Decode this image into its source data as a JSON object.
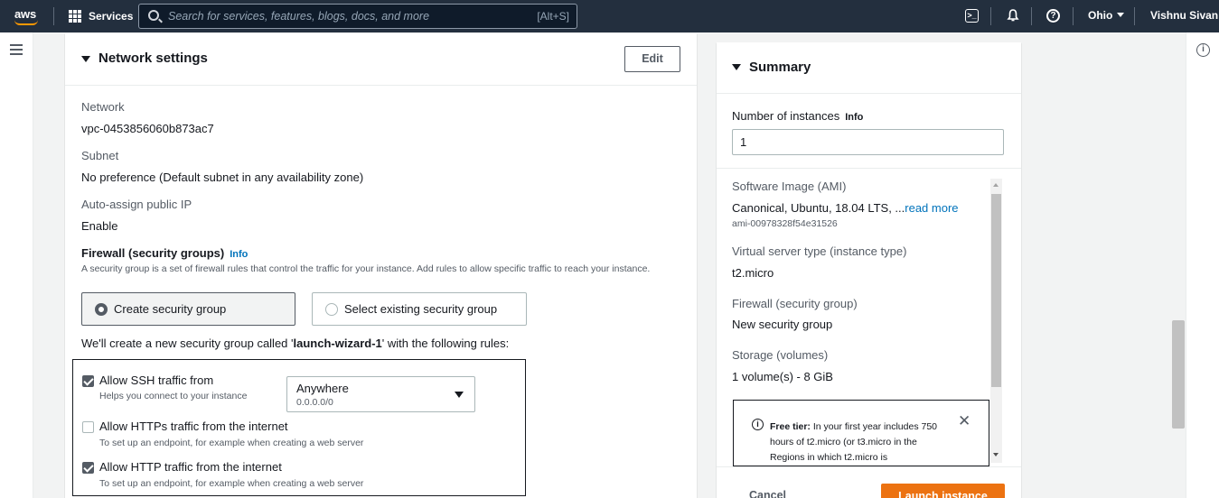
{
  "topnav": {
    "logo_text": "aws",
    "services_label": "Services",
    "search_placeholder": "Search for services, features, blogs, docs, and more",
    "search_shortcut": "[Alt+S]",
    "region": "Ohio",
    "user": "Vishnu Sivan",
    "icons": [
      "cloudshell-icon",
      "bell-icon",
      "help-icon"
    ]
  },
  "network": {
    "title": "Network settings",
    "edit_label": "Edit",
    "network_label": "Network",
    "network_value": "vpc-0453856060b873ac7",
    "subnet_label": "Subnet",
    "subnet_value": "No preference (Default subnet in any availability zone)",
    "public_ip_label": "Auto-assign public IP",
    "public_ip_value": "Enable",
    "firewall_label": "Firewall (security groups)",
    "info": "Info",
    "firewall_desc": "A security group is a set of firewall rules that control the traffic for your instance. Add rules to allow specific traffic to reach your instance.",
    "option_create": "Create security group",
    "option_existing": "Select existing security group",
    "sg_note_prefix": "We'll create a new security group called '",
    "sg_name": "launch-wizard-1",
    "sg_note_suffix": "' with the following rules:",
    "rules": [
      {
        "label": "Allow SSH traffic from",
        "sub": "Helps you connect to your instance",
        "checked": true
      },
      {
        "label": "Allow HTTPs traffic from the internet",
        "sub": "To set up an endpoint, for example when creating a web server",
        "checked": false
      },
      {
        "label": "Allow HTTP traffic from the internet",
        "sub": "To set up an endpoint, for example when creating a web server",
        "checked": true
      }
    ],
    "ssh_source": "Anywhere",
    "ssh_source_cidr": "0.0.0.0/0"
  },
  "summary": {
    "title": "Summary",
    "instances_label": "Number of instances",
    "info": "Info",
    "instances_value": "1",
    "ami_label": "Software Image (AMI)",
    "ami_value": "Canonical, Ubuntu, 18.04 LTS, ...",
    "read_more": "read more",
    "ami_id": "ami-00978328f54e31526",
    "type_label": "Virtual server type (instance type)",
    "type_value": "t2.micro",
    "firewall_label": "Firewall (security group)",
    "firewall_value": "New security group",
    "storage_label": "Storage (volumes)",
    "storage_value": "1 volume(s) - 8 GiB",
    "free_tier_bold": "Free tier:",
    "free_tier_text": " In your first year includes 750 hours of t2.micro (or t3.micro in the Regions in which t2.micro is",
    "cancel_label": "Cancel",
    "launch_label": "Launch instance"
  }
}
